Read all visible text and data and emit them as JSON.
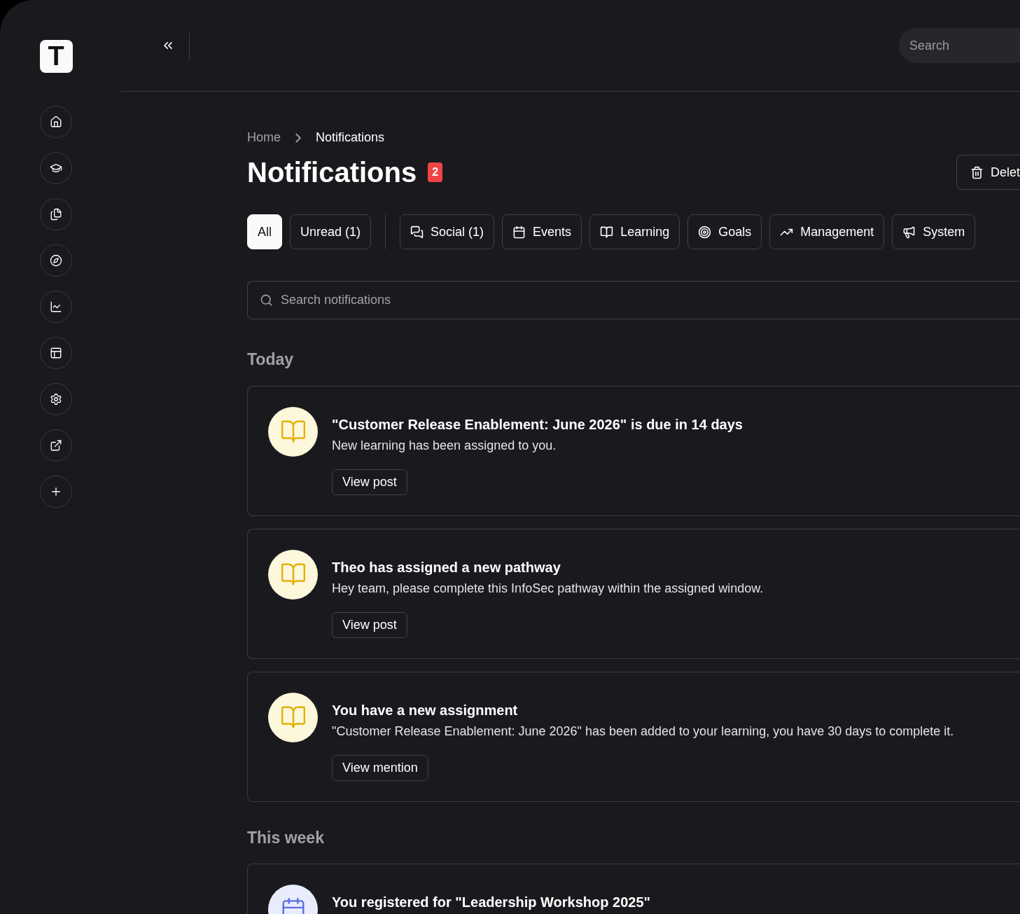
{
  "header": {
    "search": {
      "placeholder": "Search"
    }
  },
  "sidebar": {
    "logo": "T",
    "items": [
      {
        "kind": "home"
      },
      {
        "kind": "graduation"
      },
      {
        "kind": "copies"
      },
      {
        "kind": "compass"
      },
      {
        "kind": "chart"
      },
      {
        "kind": "layout"
      },
      {
        "kind": "settings"
      },
      {
        "kind": "external"
      },
      {
        "kind": "plus"
      }
    ]
  },
  "breadcrumb": [
    "Home",
    "Notifications"
  ],
  "title": "Notifications",
  "badge": "2",
  "delete_button": "Delet",
  "filters": [
    {
      "label": "All",
      "kind": "status",
      "selected": true
    },
    {
      "label": "Unread (1)",
      "kind": "status",
      "selected": false
    },
    {
      "label": "Social (1)",
      "kind": "social",
      "selected": false
    },
    {
      "label": "Events",
      "kind": "events",
      "selected": false
    },
    {
      "label": "Learning",
      "kind": "learning",
      "selected": false
    },
    {
      "label": "Goals",
      "kind": "goals",
      "selected": false
    },
    {
      "label": "Management",
      "kind": "management",
      "selected": false
    },
    {
      "label": "System",
      "kind": "system",
      "selected": false
    }
  ],
  "search": {
    "placeholder": "Search notifications"
  },
  "groups": [
    {
      "title": "Today",
      "items": [
        {
          "kind": "learning",
          "title": "\"Customer Release Enablement: June 2026\" is due in 14 days",
          "body": "New learning has been assigned to you.",
          "action": "View post"
        },
        {
          "kind": "learning",
          "title": "Theo has assigned a new pathway",
          "body": "Hey team, please complete this InfoSec pathway within the assigned window.",
          "action": "View post"
        },
        {
          "kind": "learning",
          "title": "You have a new assignment",
          "body": "\"Customer Release Enablement: June 2026\" has been added to your learning, you have 30 days to complete it.",
          "action": "View mention"
        }
      ]
    },
    {
      "title": "This week",
      "items": [
        {
          "kind": "event",
          "title": "You registered for \"Leadership Workshop 2025\""
        }
      ]
    }
  ]
}
